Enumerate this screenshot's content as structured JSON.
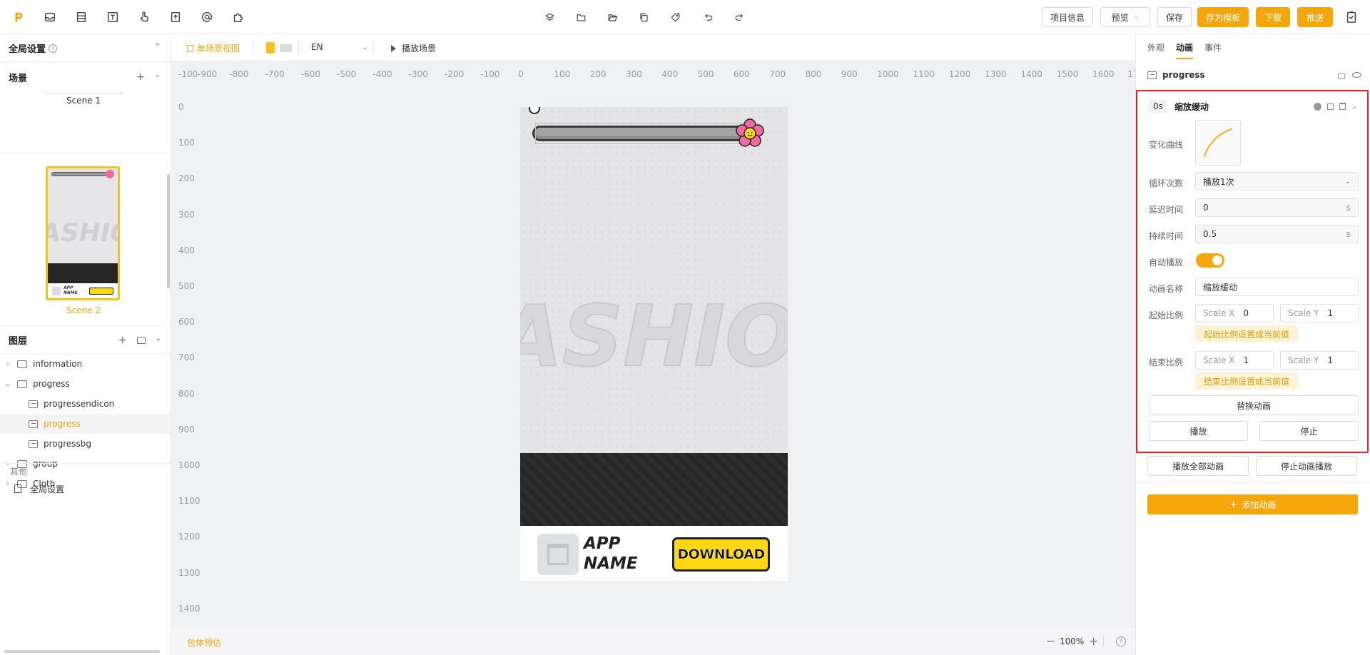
{
  "toolbar": {
    "left_icons": [
      "logo-icon",
      "inbox-icon",
      "layers-stack-icon",
      "text-icon",
      "hand-pointer-icon",
      "file-upload-icon",
      "at-sign-icon",
      "puzzle-icon"
    ],
    "center_icons": [
      "layers-icon",
      "folder-icon",
      "folder-open-icon",
      "copy-icon",
      "tag-icon",
      "undo-icon",
      "redo-icon"
    ],
    "project_info": "项目信息",
    "preview": "预览",
    "save": "保存",
    "save_template": "存为模板",
    "download": "下载",
    "push": "推送"
  },
  "left": {
    "global_settings": "全局设置",
    "scenes_title": "场景",
    "scene1_label": "Scene 1",
    "scene2_label": "Scene 2",
    "layers_title": "图层",
    "layers": [
      {
        "label": "information",
        "type": "folder",
        "collapsed": true
      },
      {
        "label": "progress",
        "type": "folder",
        "collapsed": false
      },
      {
        "label": "progressendicon",
        "type": "image"
      },
      {
        "label": "progress",
        "type": "image",
        "selected": true
      },
      {
        "label": "progressbg",
        "type": "image"
      },
      {
        "label": "group",
        "type": "folder",
        "collapsed": true
      },
      {
        "label": "Cloth",
        "type": "folder",
        "collapsed": true
      }
    ],
    "other_title": "其他",
    "global_settings_item": "全局设置"
  },
  "canvas": {
    "single_scene_view": "单场景视图",
    "language": "EN",
    "play_scene": "播放场景",
    "ruler_x": [
      "-100",
      "-900",
      "-800",
      "-700",
      "-600",
      "-500",
      "-400",
      "-300",
      "-200",
      "-100",
      "0",
      "100",
      "200",
      "300",
      "400",
      "500",
      "600",
      "700",
      "800",
      "900",
      "1000",
      "1100",
      "1200",
      "1300",
      "1400",
      "1500",
      "1600",
      "17"
    ],
    "ruler_y": [
      "0",
      "100",
      "200",
      "300",
      "400",
      "500",
      "600",
      "700",
      "800",
      "900",
      "1000",
      "1100",
      "1200",
      "1300",
      "1400"
    ],
    "fashion_text": "ASHIO",
    "app_name_1": "APP",
    "app_name_2": "NAME",
    "download_cta": "DOWNLOAD",
    "package_estimate": "包体预估",
    "zoom": "100%"
  },
  "right": {
    "tabs": [
      "外观",
      "动画",
      "事件"
    ],
    "active_tab": "动画",
    "element_name": "progress",
    "anim_time": "0s",
    "anim_name": "缩放缓动",
    "curve_label": "变化曲线",
    "loop_label": "循环次数",
    "loop_value": "播放1次",
    "delay_label": "延迟时间",
    "delay_value": "0",
    "delay_unit": "s",
    "duration_label": "持续时间",
    "duration_value": "0.5",
    "duration_unit": "s",
    "autoplay_label": "自动播放",
    "autoplay_on": true,
    "name_label": "动画名称",
    "name_value": "缩放缓动",
    "start_scale_label": "起始比例",
    "start_scale_x_label": "Scale X",
    "start_scale_x": "0",
    "start_scale_y_label": "Scale Y",
    "start_scale_y": "1",
    "start_set_current": "起始比例设置成当前值",
    "end_scale_label": "结束比例",
    "end_scale_x_label": "Scale X",
    "end_scale_x": "1",
    "end_scale_y_label": "Scale Y",
    "end_scale_y": "1",
    "end_set_current": "结束比例设置成当前值",
    "replace_anim": "替换动画",
    "play": "播放",
    "stop": "停止",
    "play_all": "播放全部动画",
    "stop_all": "停止动画播放",
    "add_anim": "添加动画"
  },
  "colors": {
    "accent": "#f5a60a",
    "highlight": "#e02020",
    "phone_dark": "#262626",
    "cta_yellow": "#ffd712"
  }
}
